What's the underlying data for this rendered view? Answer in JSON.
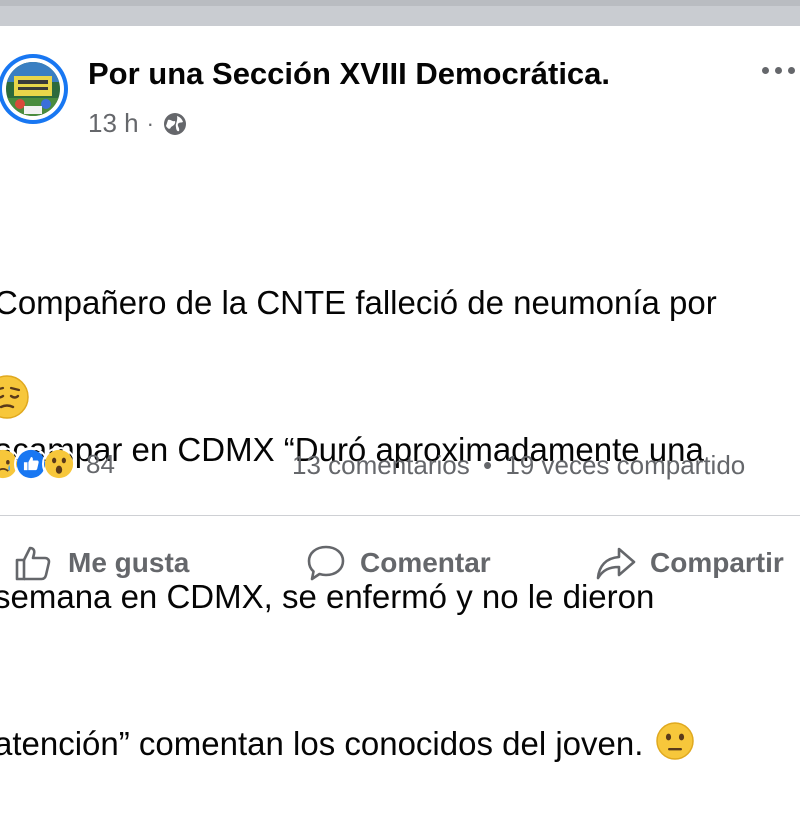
{
  "post": {
    "page_name": "Por una Sección XVIII Democrática.",
    "time": "13 h",
    "dot": "·",
    "audience_icon": "globe-icon",
    "more_icon": "more-options-icon",
    "text_lines": [
      "Compañero de la CNTE falleció de neumonía por",
      "acampar en CDMX “Duró aproximadamente una",
      "semana en CDMX, se enfermó y no le dieron",
      "atención” comentan los conocidos del joven. "
    ],
    "emojis": [
      "neutral-face-emoji",
      "pensive-face-emoji"
    ]
  },
  "engagement": {
    "reaction_icons": [
      "sad-reaction-icon",
      "like-reaction-icon",
      "wow-reaction-icon"
    ],
    "reaction_count": "84",
    "comments": "13 comentarios",
    "separator": "•",
    "shares": "19 veces compartido"
  },
  "actions": {
    "like": "Me gusta",
    "comment": "Comentar",
    "share": "Compartir"
  },
  "colors": {
    "accent": "#1877f2",
    "secondary_text": "#65676b",
    "primary_text": "#050505",
    "divider": "#ced0d4"
  }
}
